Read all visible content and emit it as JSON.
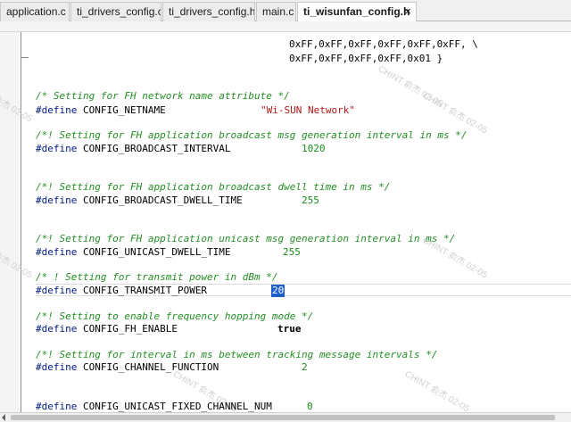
{
  "tabs": [
    {
      "label": "application.c",
      "active": false
    },
    {
      "label": "ti_drivers_config.c",
      "active": false
    },
    {
      "label": "ti_drivers_config.h",
      "active": false
    },
    {
      "label": "main.c",
      "active": false
    },
    {
      "label": "ti_wisunfan_config.h",
      "active": true
    }
  ],
  "close_glyph": "×",
  "watermark": "CHINT 俞杰 02-05",
  "code": {
    "l1": "0xFF,0xFF,0xFF,0xFF,0xFF,0xFF, \\",
    "l2": "0xFF,0xFF,0xFF,0xFF,0x01 }",
    "c_netname": "/* Setting for FH network name attribute */",
    "d_netname": "#define",
    "n_netname": "CONFIG_NETNAME",
    "v_netname": "\"Wi-SUN Network\"",
    "c_bcint": "/*! Setting for FH application broadcast msg generation interval in ms */",
    "d_bcint": "#define",
    "n_bcint": "CONFIG_BROADCAST_INTERVAL",
    "v_bcint": "1020",
    "c_bcdwell": "/*! Setting for FH application broadcast dwell time in ms */",
    "d_bcdwell": "#define",
    "n_bcdwell": "CONFIG_BROADCAST_DWELL_TIME",
    "v_bcdwell": "255",
    "c_ucdwell": "/*! Setting for FH application unicast msg generation interval in ms */",
    "d_ucdwell": "#define",
    "n_ucdwell": "CONFIG_UNICAST_DWELL_TIME",
    "v_ucdwell": "255",
    "c_txpow": "/* ! Setting for transmit power in dBm */",
    "d_txpow": "#define",
    "n_txpow": "CONFIG_TRANSMIT_POWER",
    "v_txpow": "20",
    "c_fh": "/*! Setting to enable frequency hopping mode */",
    "d_fh": "#define",
    "n_fh": "CONFIG_FH_ENABLE",
    "v_fh": "true",
    "c_chan": "/*! Setting for interval in ms between tracking message intervals */",
    "d_chan": "#define",
    "n_chan": "CONFIG_CHANNEL_FUNCTION",
    "v_chan": "2",
    "d_ucfix": "#define",
    "n_ucfix": "CONFIG_UNICAST_FIXED_CHANNEL_NUM",
    "v_ucfix": "0"
  },
  "colors": {
    "comment": "#238e23",
    "preprocessor": "#001a80",
    "number": "#1a8a1a",
    "string": "#b01818",
    "selection": "#1e5fcc"
  }
}
